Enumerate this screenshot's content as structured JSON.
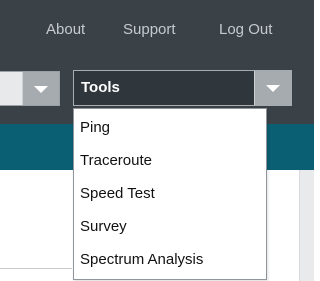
{
  "header": {
    "links": {
      "about": "About",
      "support": "Support",
      "logout": "Log Out"
    }
  },
  "left_dropdown": {
    "selected_label": "",
    "icon": "chevron-down-icon"
  },
  "tools_dropdown": {
    "selected_label": "Tools",
    "icon": "chevron-down-icon",
    "open": true,
    "options": [
      "Ping",
      "Traceroute",
      "Speed Test",
      "Survey",
      "Spectrum Analysis"
    ]
  },
  "colors": {
    "header_bg": "#3a4147",
    "accent_teal": "#0a5f72",
    "dropdown_bg": "#2f363c",
    "arrow_box": "#a6abb0",
    "link_text": "#c6cace"
  }
}
